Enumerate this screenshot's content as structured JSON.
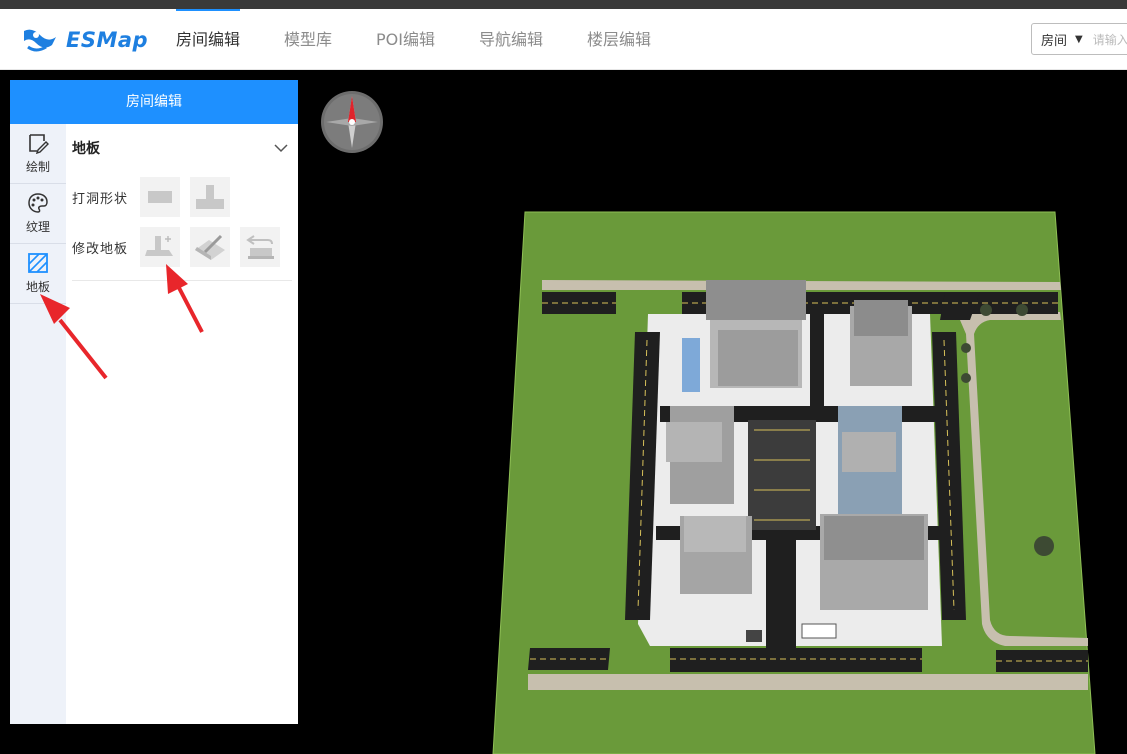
{
  "app": {
    "logo_text": "ESMap"
  },
  "nav": {
    "tabs": [
      {
        "label": "房间编辑",
        "active": true
      },
      {
        "label": "模型库",
        "active": false
      },
      {
        "label": "POI编辑",
        "active": false
      },
      {
        "label": "导航编辑",
        "active": false
      },
      {
        "label": "楼层编辑",
        "active": false
      }
    ]
  },
  "room_select": {
    "value": "房间",
    "placeholder": "请输入"
  },
  "panel": {
    "title": "房间编辑",
    "side_items": [
      {
        "label": "绘制",
        "icon": "draw-icon",
        "active": false
      },
      {
        "label": "纹理",
        "icon": "palette-icon",
        "active": false
      },
      {
        "label": "地板",
        "icon": "floor-icon",
        "active": true
      }
    ],
    "section": {
      "title": "地板",
      "rows": [
        {
          "label": "打洞形状",
          "tools": [
            "rect-hole-icon",
            "t-hole-icon"
          ]
        },
        {
          "label": "修改地板",
          "tools": [
            "floor-extend-icon",
            "floor-slice-icon",
            "floor-restore-icon"
          ]
        }
      ]
    }
  },
  "colors": {
    "accent": "#1e90ff",
    "grass": "#6a9a3a",
    "road": "#1f1f1f",
    "plaza": "#ececec"
  }
}
